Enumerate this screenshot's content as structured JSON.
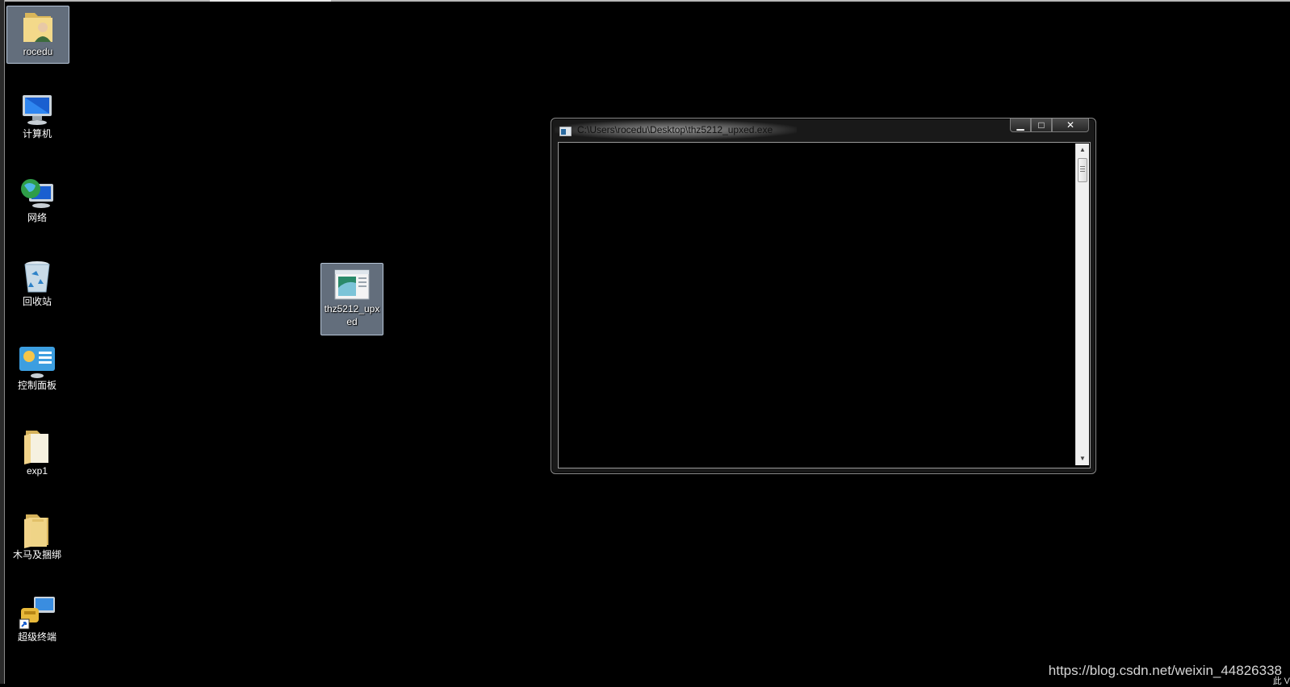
{
  "desktop": {
    "icons": [
      {
        "label": "rocedu",
        "icon": "user-folder-icon"
      },
      {
        "label": "计算机",
        "icon": "computer-icon"
      },
      {
        "label": "网络",
        "icon": "network-icon"
      },
      {
        "label": "回收站",
        "icon": "recycle-bin-icon"
      },
      {
        "label": "控制面板",
        "icon": "control-panel-icon"
      },
      {
        "label": "exp1",
        "icon": "folder-icon"
      },
      {
        "label": "木马及捆绑",
        "icon": "folder-icon"
      },
      {
        "label": "超级终端",
        "icon": "hyperterminal-icon"
      }
    ],
    "exe_icon": {
      "label": "thz5212_upxed",
      "icon": "exe-app-icon"
    }
  },
  "console_window": {
    "title": "C:\\Users\\rocedu\\Desktop\\thz5212_upxed.exe",
    "minimize": "▁",
    "maximize": "□",
    "close": "✕"
  },
  "watermark": "https://blog.csdn.net/weixin_44826338",
  "corner_text": "此 V",
  "colors": {
    "desktop_bg": "#000000",
    "selection": "#b4c8e1"
  }
}
